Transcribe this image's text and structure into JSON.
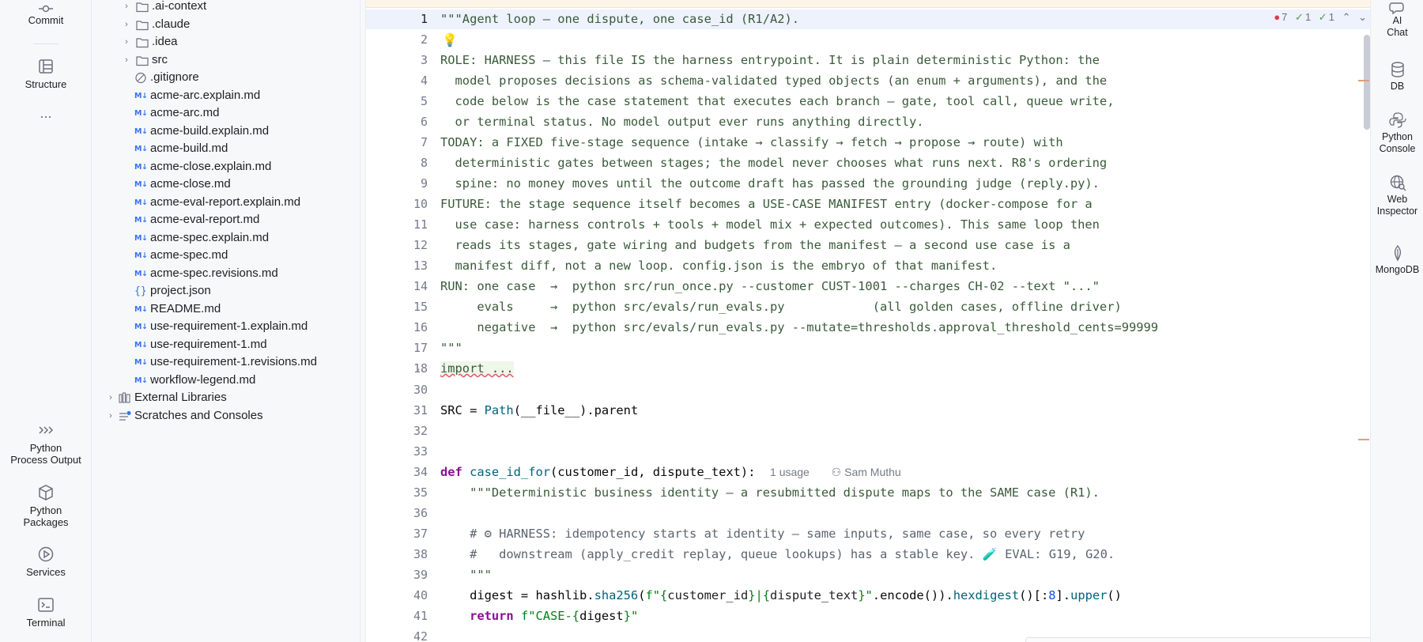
{
  "left_tools": {
    "commit": "Commit",
    "structure": "Structure",
    "more": "...",
    "python_process_output_1": "Python",
    "python_process_output_2": "Process Output",
    "python_packages_1": "Python",
    "python_packages_2": "Packages",
    "services": "Services",
    "terminal": "Terminal"
  },
  "project_tree": {
    "items": [
      {
        "label": ".ai-context",
        "kind": "folder"
      },
      {
        "label": ".claude",
        "kind": "folder"
      },
      {
        "label": ".idea",
        "kind": "folder"
      },
      {
        "label": "src",
        "kind": "folder"
      },
      {
        "label": ".gitignore",
        "kind": "ignore"
      },
      {
        "label": "acme-arc.explain.md",
        "kind": "md"
      },
      {
        "label": "acme-arc.md",
        "kind": "md"
      },
      {
        "label": "acme-build.explain.md",
        "kind": "md"
      },
      {
        "label": "acme-build.md",
        "kind": "md"
      },
      {
        "label": "acme-close.explain.md",
        "kind": "md"
      },
      {
        "label": "acme-close.md",
        "kind": "md"
      },
      {
        "label": "acme-eval-report.explain.md",
        "kind": "md"
      },
      {
        "label": "acme-eval-report.md",
        "kind": "md"
      },
      {
        "label": "acme-spec.explain.md",
        "kind": "md"
      },
      {
        "label": "acme-spec.md",
        "kind": "md"
      },
      {
        "label": "acme-spec.revisions.md",
        "kind": "md"
      },
      {
        "label": "project.json",
        "kind": "json"
      },
      {
        "label": "README.md",
        "kind": "md"
      },
      {
        "label": "use-requirement-1.explain.md",
        "kind": "md"
      },
      {
        "label": "use-requirement-1.md",
        "kind": "md"
      },
      {
        "label": "use-requirement-1.revisions.md",
        "kind": "md"
      },
      {
        "label": "workflow-legend.md",
        "kind": "md"
      },
      {
        "label": "External Libraries",
        "kind": "libraries"
      },
      {
        "label": "Scratches and Consoles",
        "kind": "scratches"
      }
    ],
    "md_icon": "M↓",
    "json_icon": "{}"
  },
  "editor": {
    "inspection": {
      "errors": "7",
      "warnings": "1",
      "weak": "1"
    },
    "line_numbers": [
      "1",
      "2",
      "3",
      "4",
      "5",
      "6",
      "7",
      "8",
      "9",
      "10",
      "11",
      "12",
      "13",
      "14",
      "15",
      "16",
      "17",
      "18",
      "30",
      "31",
      "32",
      "33",
      "34",
      "35",
      "36",
      "37",
      "38",
      "39",
      "40",
      "41",
      "42"
    ],
    "lines": {
      "l1": "\"\"\"Agent loop — one dispute, one case_id (R1/A2).",
      "l3": "ROLE: HARNESS — this file IS the harness entrypoint. It is plain deterministic Python: the",
      "l4": "  model proposes decisions as schema-validated typed objects (an enum + arguments), and the",
      "l5": "  code below is the case statement that executes each branch — gate, tool call, queue write,",
      "l6": "  or terminal status. No model output ever runs anything directly.",
      "l7": "TODAY: a FIXED five-stage sequence (intake → classify → fetch → propose → route) with",
      "l8": "  deterministic gates between stages; the model never chooses what runs next. R8's ordering",
      "l9": "  spine: no money moves until the outcome draft has passed the grounding judge (reply.py).",
      "l10": "FUTURE: the stage sequence itself becomes a USE-CASE MANIFEST entry (docker-compose for a",
      "l11": "  use case: harness controls + tools + model mix + expected outcomes). This same loop then",
      "l12": "  reads its stages, gate wiring and budgets from the manifest — a second use case is a",
      "l13": "  manifest diff, not a new loop. config.json is the embryo of that manifest.",
      "l14": "RUN: one case  →  python src/run_once.py --customer CUST-1001 --charges CH-02 --text \"...\"",
      "l15": "     evals     →  python src/evals/run_evals.py            (all golden cases, offline driver)",
      "l16": "     negative  →  python src/evals/run_evals.py --mutate=thresholds.approval_threshold_cents=99999",
      "l17": "\"\"\"",
      "l18": "import ...",
      "l31_a": "SRC = ",
      "l31_b": "Path",
      "l31_c": "(__file__).parent",
      "l34_def": "def ",
      "l34_name": "case_id_for",
      "l34_args": "(customer_id, dispute_text):",
      "l34_usages": "1 usage",
      "l34_author": "Sam Muthu",
      "l35": "    \"\"\"Deterministic business identity — a resubmitted dispute maps to the SAME case (R1).",
      "l37": "    # ⚙ HARNESS: idempotency starts at identity — same inputs, same case, so every retry",
      "l38": "    #   downstream (apply_credit replay, queue lookups) has a stable key. 🧪 EVAL: G19, G20.",
      "l39": "    \"\"\"",
      "l40_a": "    digest = hashlib.",
      "l40_b": "sha256",
      "l40_c": "(",
      "l40_d": "f\"{",
      "l40_e": "customer_id",
      "l40_f": "}|{",
      "l40_g": "dispute_text",
      "l40_h": "}\"",
      "l40_i": ".encode()).",
      "l40_j": "hexdigest",
      "l40_k": "()[:",
      "l40_l": "8",
      "l40_m": "].",
      "l40_n": "upper",
      "l40_o": "()",
      "l41_a": "    return ",
      "l41_b": "f\"CASE-{",
      "l41_c": "digest",
      "l41_d": "}\""
    }
  },
  "right_tools": {
    "ai_chat_1": "AI",
    "ai_chat_2": "Chat",
    "db": "DB",
    "python_console_1": "Python",
    "python_console_2": "Console",
    "web_inspector_1": "Web",
    "web_inspector_2": "Inspector",
    "mongodb": "MongoDB"
  }
}
